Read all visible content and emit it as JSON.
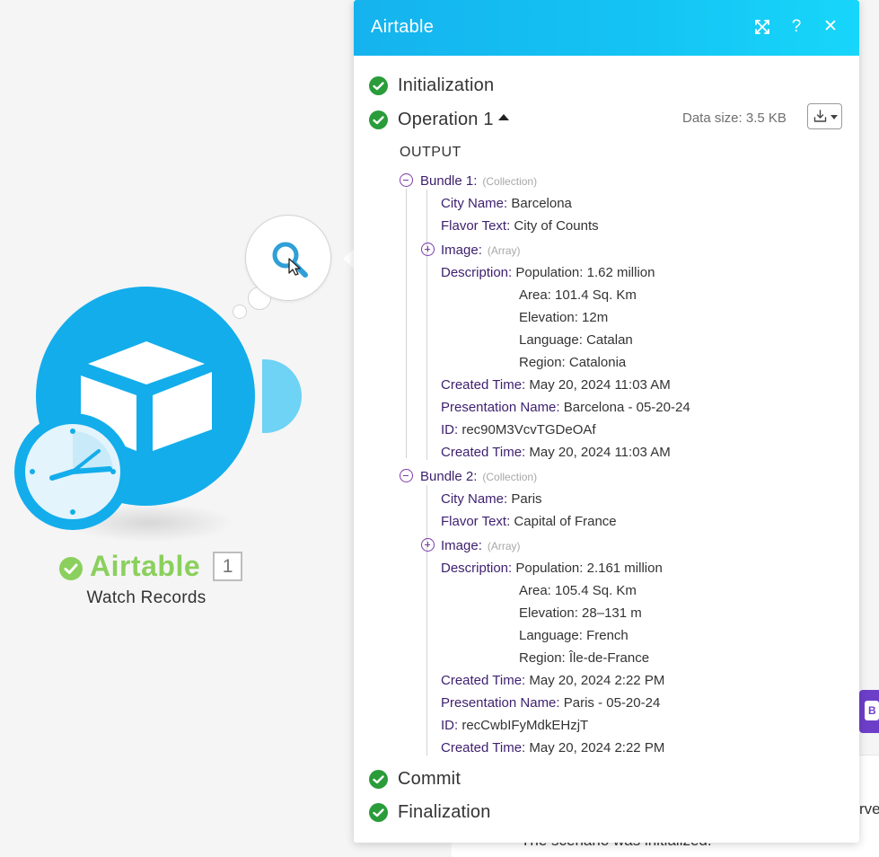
{
  "module": {
    "title": "Airtable",
    "subtitle": "Watch Records",
    "operations_count": "1",
    "brand_color": "#13adeb",
    "success_color": "#8bd05e",
    "icons": [
      "airtable-cube-icon",
      "clock-icon",
      "magnifier-icon"
    ]
  },
  "background": {
    "caption": "The scenario was initialized.",
    "edge_text": "rve",
    "button_letter": "B"
  },
  "panel": {
    "title": "Airtable",
    "header_buttons": [
      "expand-icon",
      "help-icon",
      "close-icon"
    ],
    "help_label": "?",
    "close_label": "✕",
    "steps": {
      "initialization": "Initialization",
      "operation": "Operation 1",
      "commit": "Commit",
      "finalization": "Finalization"
    },
    "data_size": "Data size: 3.5 KB",
    "output_label": "OUTPUT",
    "bundles": [
      {
        "label": "Bundle 1:",
        "type": "(Collection)",
        "city_name_key": "City Name:",
        "city_name": "Barcelona",
        "flavor_key": "Flavor Text:",
        "flavor": "City of Counts",
        "image_key": "Image:",
        "image_type": "(Array)",
        "description_key": "Description:",
        "description": [
          "Population: 1.62 million",
          "Area: 101.4 Sq. Km",
          "Elevation: 12m",
          "Language: Catalan",
          "Region: Catalonia"
        ],
        "created_key": "Created Time:",
        "created": "May 20, 2024 11:03 AM",
        "presentation_key": "Presentation Name:",
        "presentation": "Barcelona - 05-20-24",
        "id_key": "ID:",
        "id": "rec90M3VcvTGDeOAf",
        "created2_key": "Created Time:",
        "created2": "May 20, 2024 11:03 AM"
      },
      {
        "label": "Bundle 2:",
        "type": "(Collection)",
        "city_name_key": "City Name:",
        "city_name": "Paris",
        "flavor_key": "Flavor Text:",
        "flavor": "Capital of France",
        "image_key": "Image:",
        "image_type": "(Array)",
        "description_key": "Description:",
        "description": [
          "Population: 2.161 million",
          "Area: 105.4 Sq. Km",
          "Elevation: 28–131 m",
          "Language: French",
          "Region: Île-de-France"
        ],
        "created_key": "Created Time:",
        "created": "May 20, 2024 2:22 PM",
        "presentation_key": "Presentation Name:",
        "presentation": "Paris - 05-20-24",
        "id_key": "ID:",
        "id": "recCwbIFyMdkEHzjT",
        "created2_key": "Created Time:",
        "created2": "May 20, 2024 2:22 PM"
      }
    ]
  }
}
